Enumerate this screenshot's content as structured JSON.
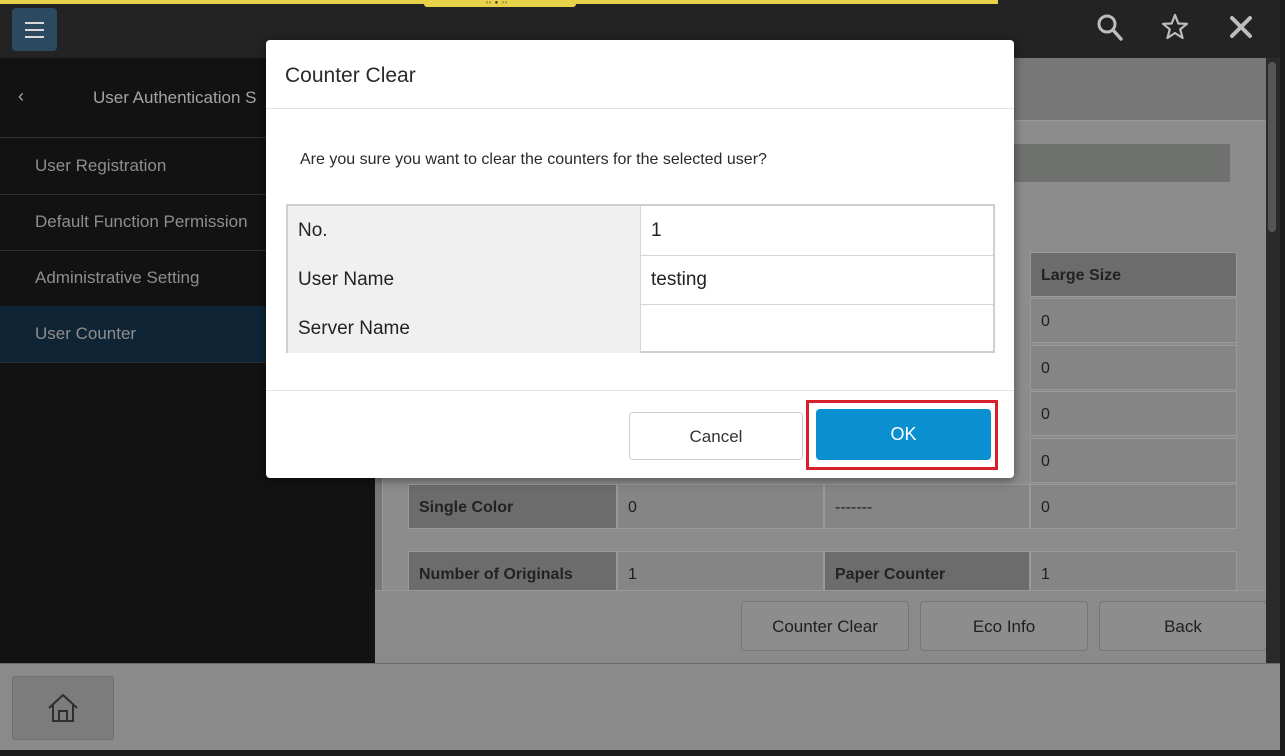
{
  "topbar": {
    "drag_handle_glyph": "‹‹ ● ››",
    "icons": [
      "menu-icon",
      "search-icon",
      "star-icon",
      "close-icon"
    ]
  },
  "sidebar": {
    "title": "User Authentication S",
    "items": [
      {
        "label": "User Registration",
        "active": false
      },
      {
        "label": "Default Function Permission",
        "active": false
      },
      {
        "label": "Administrative Setting",
        "active": false
      },
      {
        "label": "User Counter",
        "active": true
      }
    ]
  },
  "background_table": {
    "header_large_size": "Large Size",
    "large_size_values": [
      "0",
      "0",
      "0",
      "0"
    ],
    "single_color_row": {
      "label": "Single Color",
      "col1": "0",
      "col2": "-------",
      "col3": "0"
    },
    "originals_row": {
      "label": "Number of Originals",
      "value": "1",
      "label2": "Paper Counter",
      "value2": "1"
    }
  },
  "bottom_actions": {
    "counter_clear": "Counter Clear",
    "eco_info": "Eco Info",
    "back": "Back"
  },
  "dialog": {
    "title": "Counter Clear",
    "message": "Are you sure you want to clear the counters for the selected user?",
    "rows": [
      {
        "key": "No.",
        "value": "1"
      },
      {
        "key": "User Name",
        "value": "testing"
      },
      {
        "key": "Server Name",
        "value": ""
      }
    ],
    "cancel_label": "Cancel",
    "ok_label": "OK"
  },
  "colors": {
    "ok_button": "#0a8fd0",
    "highlight": "#d8202a",
    "active_sidebar": "#0f2536"
  }
}
